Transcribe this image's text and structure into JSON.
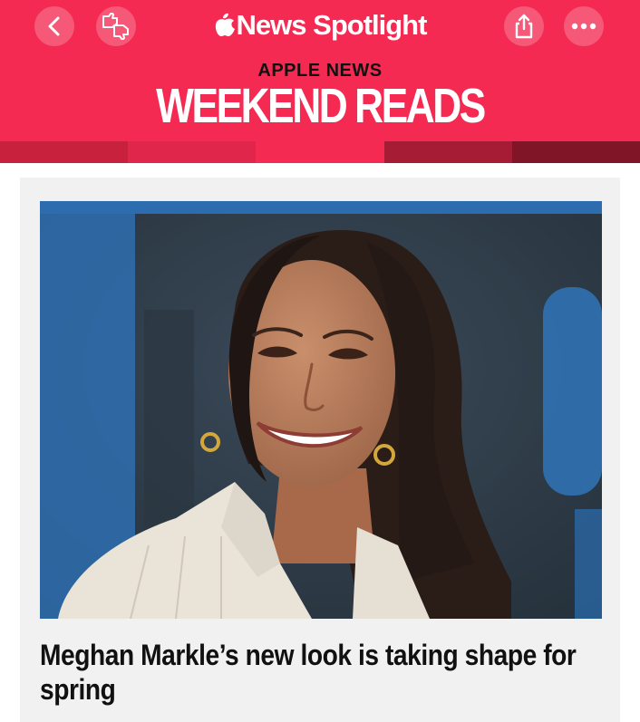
{
  "navbar": {
    "back_icon": "chevron-left-icon",
    "reaction_icon": "thumbs-up-down-icon",
    "logo_icon": "apple-logo-icon",
    "logo_text": "News Spotlight",
    "share_icon": "share-icon",
    "more_icon": "ellipsis-icon"
  },
  "banner": {
    "kicker": "APPLE NEWS",
    "title": "WEEKEND READS",
    "stripe_colors": [
      "#c8213e",
      "#e0264a",
      "#f42a52",
      "#a61c34",
      "#7f1527"
    ]
  },
  "article": {
    "image_alt": "Meghan Markle smiling, with long dark hair and gold earrings",
    "headline": "Meghan Markle’s new look is taking shape for spring"
  },
  "colors": {
    "brand": "#f42a52",
    "text": "#111111"
  }
}
